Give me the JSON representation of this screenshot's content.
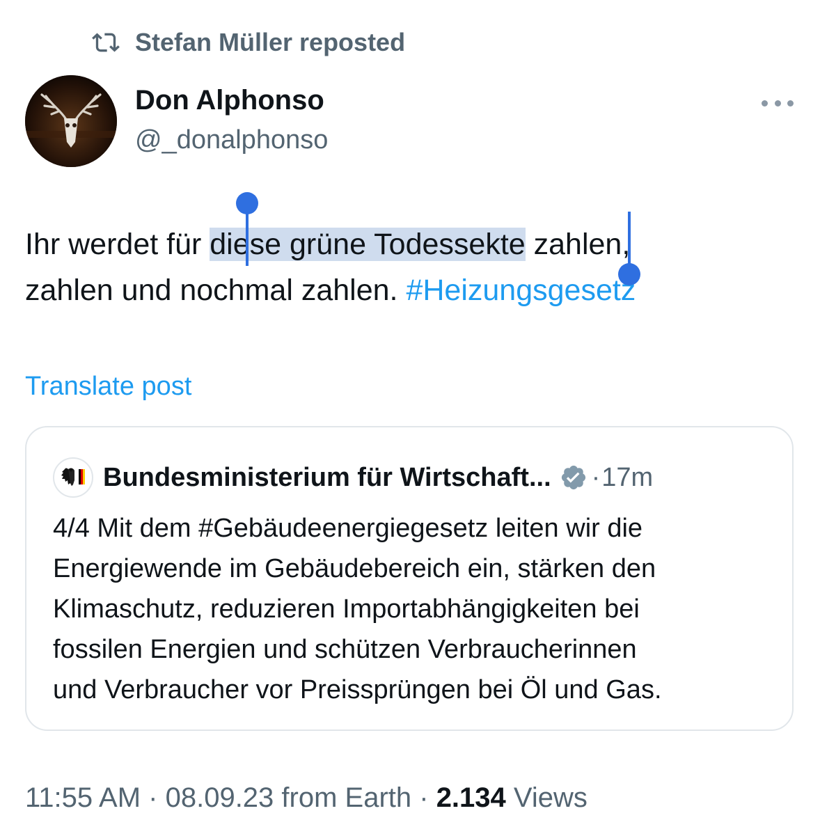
{
  "repost": {
    "text": "Stefan Müller reposted",
    "icon": "repost-icon"
  },
  "author": {
    "name": "Don Alphonso",
    "handle": "@_donalphonso"
  },
  "post": {
    "line1_before": "Ihr werdet für ",
    "line1_selected": "diese grüne Todessekte",
    "line1_after": " zahlen,",
    "line2_text": "zahlen und nochmal zahlen. ",
    "hashtag": "#Heizungsgesetz"
  },
  "translate_label": "Translate post",
  "quote": {
    "name": "Bundesministerium für Wirtschaft...",
    "separator": "·",
    "time": "17m",
    "lines": [
      "4/4 Mit dem #Gebäudeenergiegesetz leiten wir die",
      "Energiewende im Gebäudebereich ein, stärken den",
      "Klimaschutz, reduzieren Importabhängigkeiten bei",
      "fossilen Energien und schützen Verbraucherinnen",
      "und Verbraucher vor Preissprüngen bei Öl und Gas."
    ]
  },
  "footer": {
    "time": "11:55 AM",
    "separator": " · ",
    "date": "08.09.23",
    "source": " from Earth",
    "views_count": "2.134",
    "views_label": " Views"
  },
  "colors": {
    "accent": "#1d9bf0",
    "selection": "#cfdcee",
    "handle": "#2f6fe0",
    "muted": "#536471"
  }
}
